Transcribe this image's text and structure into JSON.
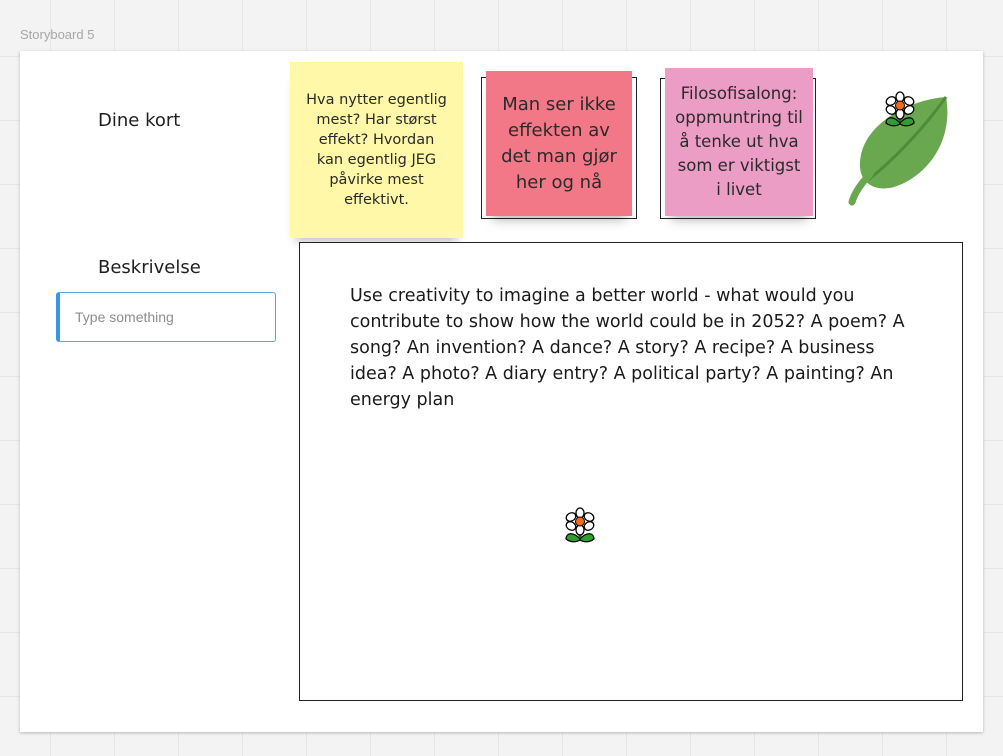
{
  "board": {
    "frame_title": "Storyboard 5"
  },
  "left_panel": {
    "cards_label": "Dine kort",
    "description_label": "Beskrivelse",
    "description_input": {
      "value": "",
      "placeholder": "Type something"
    }
  },
  "cards": [
    {
      "text": "Hva nytter egentlig mest? Har størst effekt? Hvordan kan egentlig JEG påvirke mest effektivt.",
      "color": "#fff8a8"
    },
    {
      "text": "Man ser ikke effekten av det man gjør her og nå",
      "color": "#f27887"
    },
    {
      "text": "Filosofisalong: oppmuntring til å tenke ut hva som er viktigst i livet",
      "color": "#ec9dc6"
    }
  ],
  "description_box": {
    "text": "Use creativity to imagine a better world - what would you contribute to show how the world could be in 2052? A poem? A song? An invention? A dance? A story? A recipe? A business idea? A photo? A diary entry? A political party? A painting? An energy plan"
  },
  "icons": {
    "top_flower": "daisy-flower-icon",
    "leaf": "green-leaf-icon",
    "box_flower": "daisy-flower-icon"
  },
  "colors": {
    "input_accent": "#3a96e0",
    "leaf_green": "#6aa84f"
  }
}
